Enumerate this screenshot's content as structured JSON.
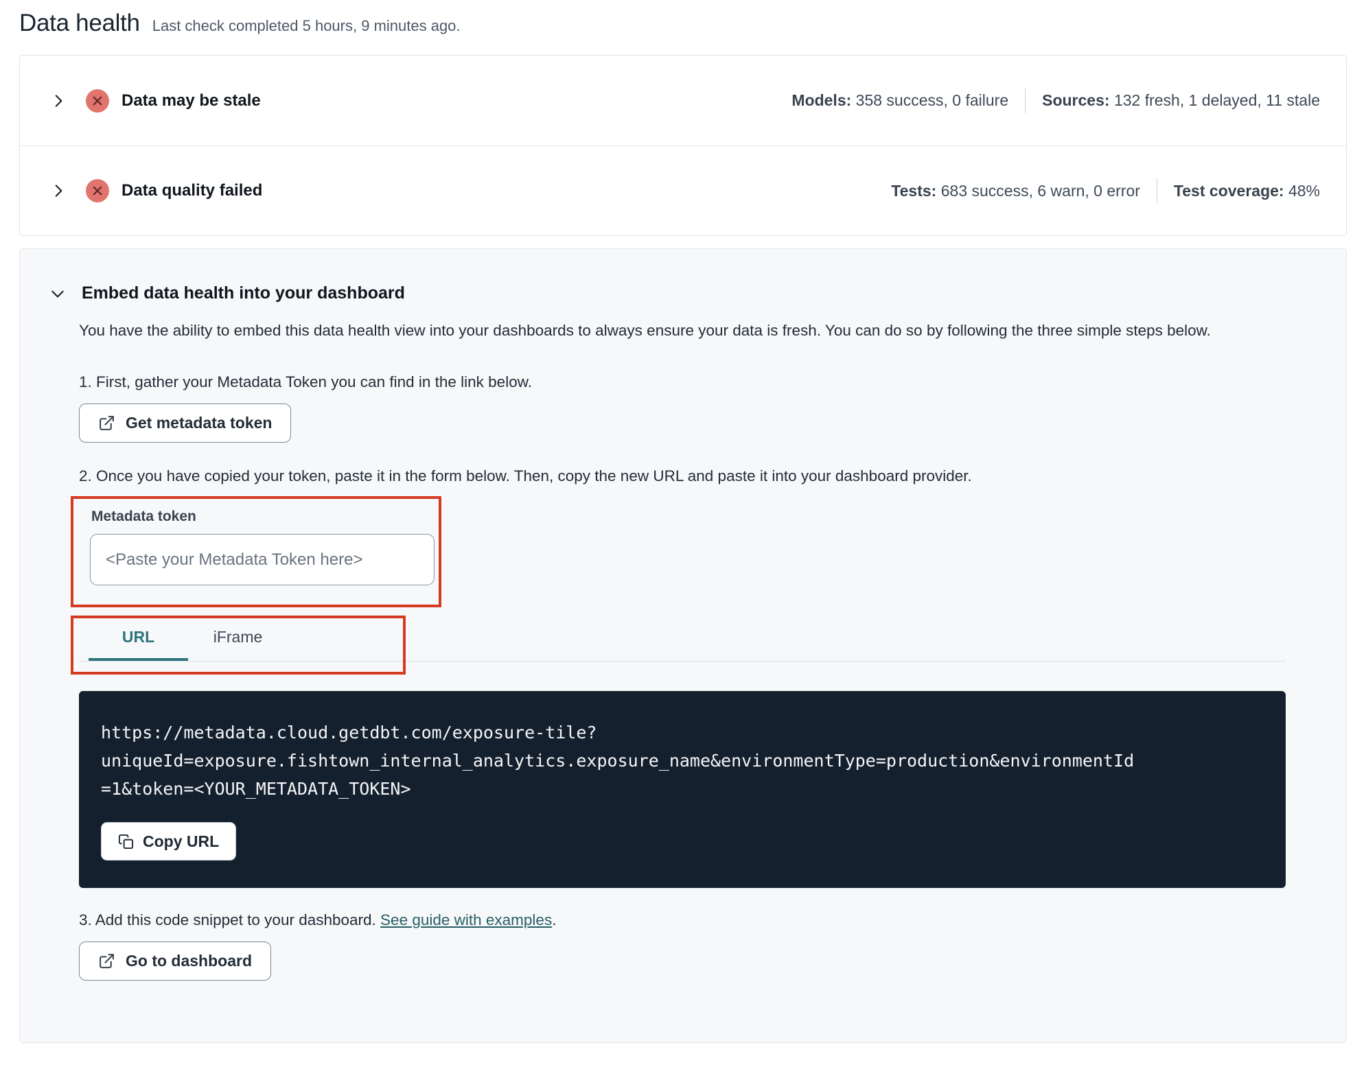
{
  "page": {
    "title": "Data health",
    "subtitle": "Last check completed 5 hours, 9 minutes ago."
  },
  "status_rows": [
    {
      "label": "Data may be stale",
      "status_icon": "x-circle-icon",
      "stats": [
        {
          "label": "Models:",
          "value": "358 success, 0 failure"
        },
        {
          "label": "Sources:",
          "value": "132 fresh, 1 delayed, 11 stale"
        }
      ]
    },
    {
      "label": "Data quality failed",
      "status_icon": "x-circle-icon",
      "stats": [
        {
          "label": "Tests:",
          "value": "683 success, 6 warn, 0 error"
        },
        {
          "label": "Test coverage:",
          "value": "48%"
        }
      ]
    }
  ],
  "embed": {
    "title": "Embed data health into your dashboard",
    "description": "You have the ability to embed this data health view into your dashboards to always ensure your data is fresh. You can do so by following the three simple steps below.",
    "step1": "1. First, gather your Metadata Token you can find in the link below.",
    "get_token_button": {
      "label": "Get metadata token",
      "icon": "external-link-icon"
    },
    "step2": "2. Once you have copied your token, paste it in the form below. Then, copy the new URL and paste it into your dashboard provider.",
    "token_field": {
      "label": "Metadata token",
      "value": "",
      "placeholder": "<Paste your Metadata Token here>"
    },
    "tabs": [
      {
        "label": "URL",
        "active": true
      },
      {
        "label": "iFrame",
        "active": false
      }
    ],
    "code_lines": {
      "line1": "https://metadata.cloud.getdbt.com/exposure-tile?",
      "line2": "uniqueId=exposure.fishtown_internal_analytics.exposure_name&environmentType=production&environmentId",
      "line3": "=1&token=<YOUR_METADATA_TOKEN>"
    },
    "copy_url_button": {
      "label": "Copy URL",
      "icon": "copy-icon"
    },
    "step3_prefix": "3. Add this code snippet to your dashboard. ",
    "step3_link": "See guide with examples",
    "step3_suffix": ".",
    "go_dashboard_button": {
      "label": "Go to dashboard",
      "icon": "external-link-icon"
    }
  },
  "colors": {
    "annotation_red": "#d63b22",
    "status_badge_bg": "#e1746d",
    "status_badge_glyph": "#59282b",
    "active_tab_teal": "#2c747c",
    "code_block_bg": "#15202e"
  }
}
